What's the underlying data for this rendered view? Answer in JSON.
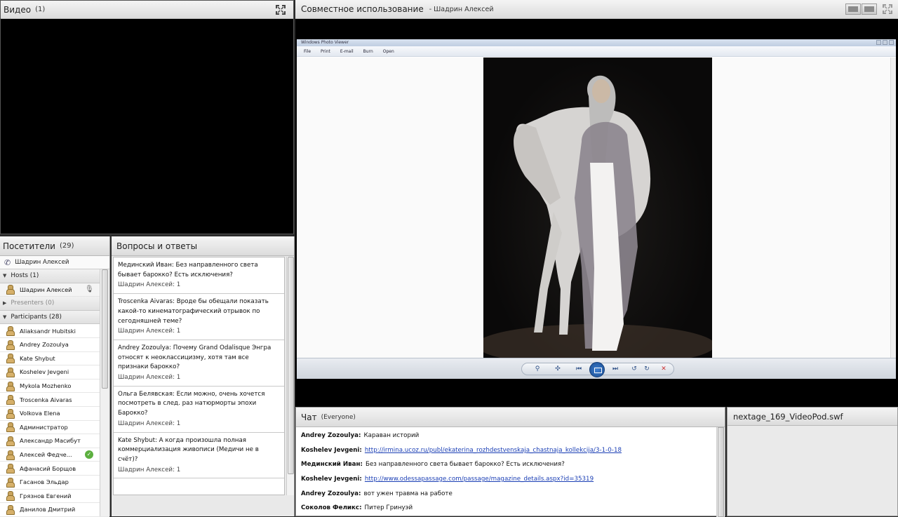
{
  "video_pod": {
    "title": "Видео",
    "count": "(1)",
    "fullscreen_icon": "fullscreen-icon"
  },
  "share_pod": {
    "title": "Совместное использование",
    "presenter": "- Шадрин Алексей",
    "viewer": {
      "window_title": "Windows Photo Viewer",
      "menu": [
        "File",
        "Print",
        "E-mail",
        "Burn",
        "Open"
      ],
      "controls": [
        "zoom",
        "fit",
        "previous",
        "slideshow",
        "next",
        "rotate-left",
        "rotate-right",
        "delete"
      ]
    }
  },
  "attendees_pod": {
    "title": "Посетители",
    "count": "(29)",
    "me": "Шадрин Алексей",
    "hosts_label": "Hosts (1)",
    "hosts": [
      "Шадрин Алексей"
    ],
    "presenters_label": "Presenters (0)",
    "participants_label": "Participants (28)",
    "participants": [
      "Aliaksandr Hubitski",
      "Andrey Zozoulya",
      "Kate Shybut",
      "Koshelev Jevgeni",
      "Mykola Mozhenko",
      "Troscenka Aivaras",
      "Volkova Elena",
      "Администратор",
      "Александр Масибут",
      "Алексей Федче...",
      "Афанасий Борщов",
      "Гасанов Эльдар",
      "Грязнов Евгений",
      "Данилов Дмитрий"
    ]
  },
  "qa_pod": {
    "title": "Вопросы и ответы",
    "items": [
      {
        "q": "Мединский Иван: Без направленного света бывает барокко? Есть исключения?",
        "a": "Шадрин Алексей: 1"
      },
      {
        "q": "Troscenka Aivaras: Вроде бы обещали показать какой-то кинематографический отрывок по сегодняшней теме?",
        "a": "Шадрин Алексей: 1"
      },
      {
        "q": "Andrey Zozoulya: Почему Grand Odalisque Энгра относят к неоклассицизму, хотя там все признаки барокко?",
        "a": "Шадрин Алексей: 1"
      },
      {
        "q": "Ольга Белявская: Если можно, очень хочется посмотреть в след. раз натюрморты эпохи Барокко?",
        "a": "Шадрин Алексей: 1"
      },
      {
        "q": "Kate Shybut: А когда произошла полная коммерциализация живописи (Медичи не в счёт)?",
        "a": "Шадрин Алексей: 1"
      }
    ]
  },
  "chat_pod": {
    "title": "Чат",
    "scope": "(Everyone)",
    "messages": [
      {
        "who": "Andrey Zozoulya:",
        "text": "Караван историй",
        "link": false
      },
      {
        "who": "Koshelev Jevgeni:",
        "text": "http://irmina.ucoz.ru/publ/ekaterina_rozhdestvenskaja_chastnaja_kollekcija/3-1-0-18",
        "link": true
      },
      {
        "who": "Мединский Иван:",
        "text": "Без направленного света бывает барокко? Есть исключения?",
        "link": false
      },
      {
        "who": "Koshelev Jevgeni:",
        "text": "http://www.odessapassage.com/passage/magazine_details.aspx?id=35319",
        "link": true
      },
      {
        "who": "Andrey Zozoulya:",
        "text": "вот ужен травма на работе",
        "link": false
      },
      {
        "who": "Соколов Феликс:",
        "text": "Питер Гринуэй",
        "link": false
      }
    ]
  },
  "video_pod_2": {
    "title": "nextage_169_VideoPod.swf"
  }
}
